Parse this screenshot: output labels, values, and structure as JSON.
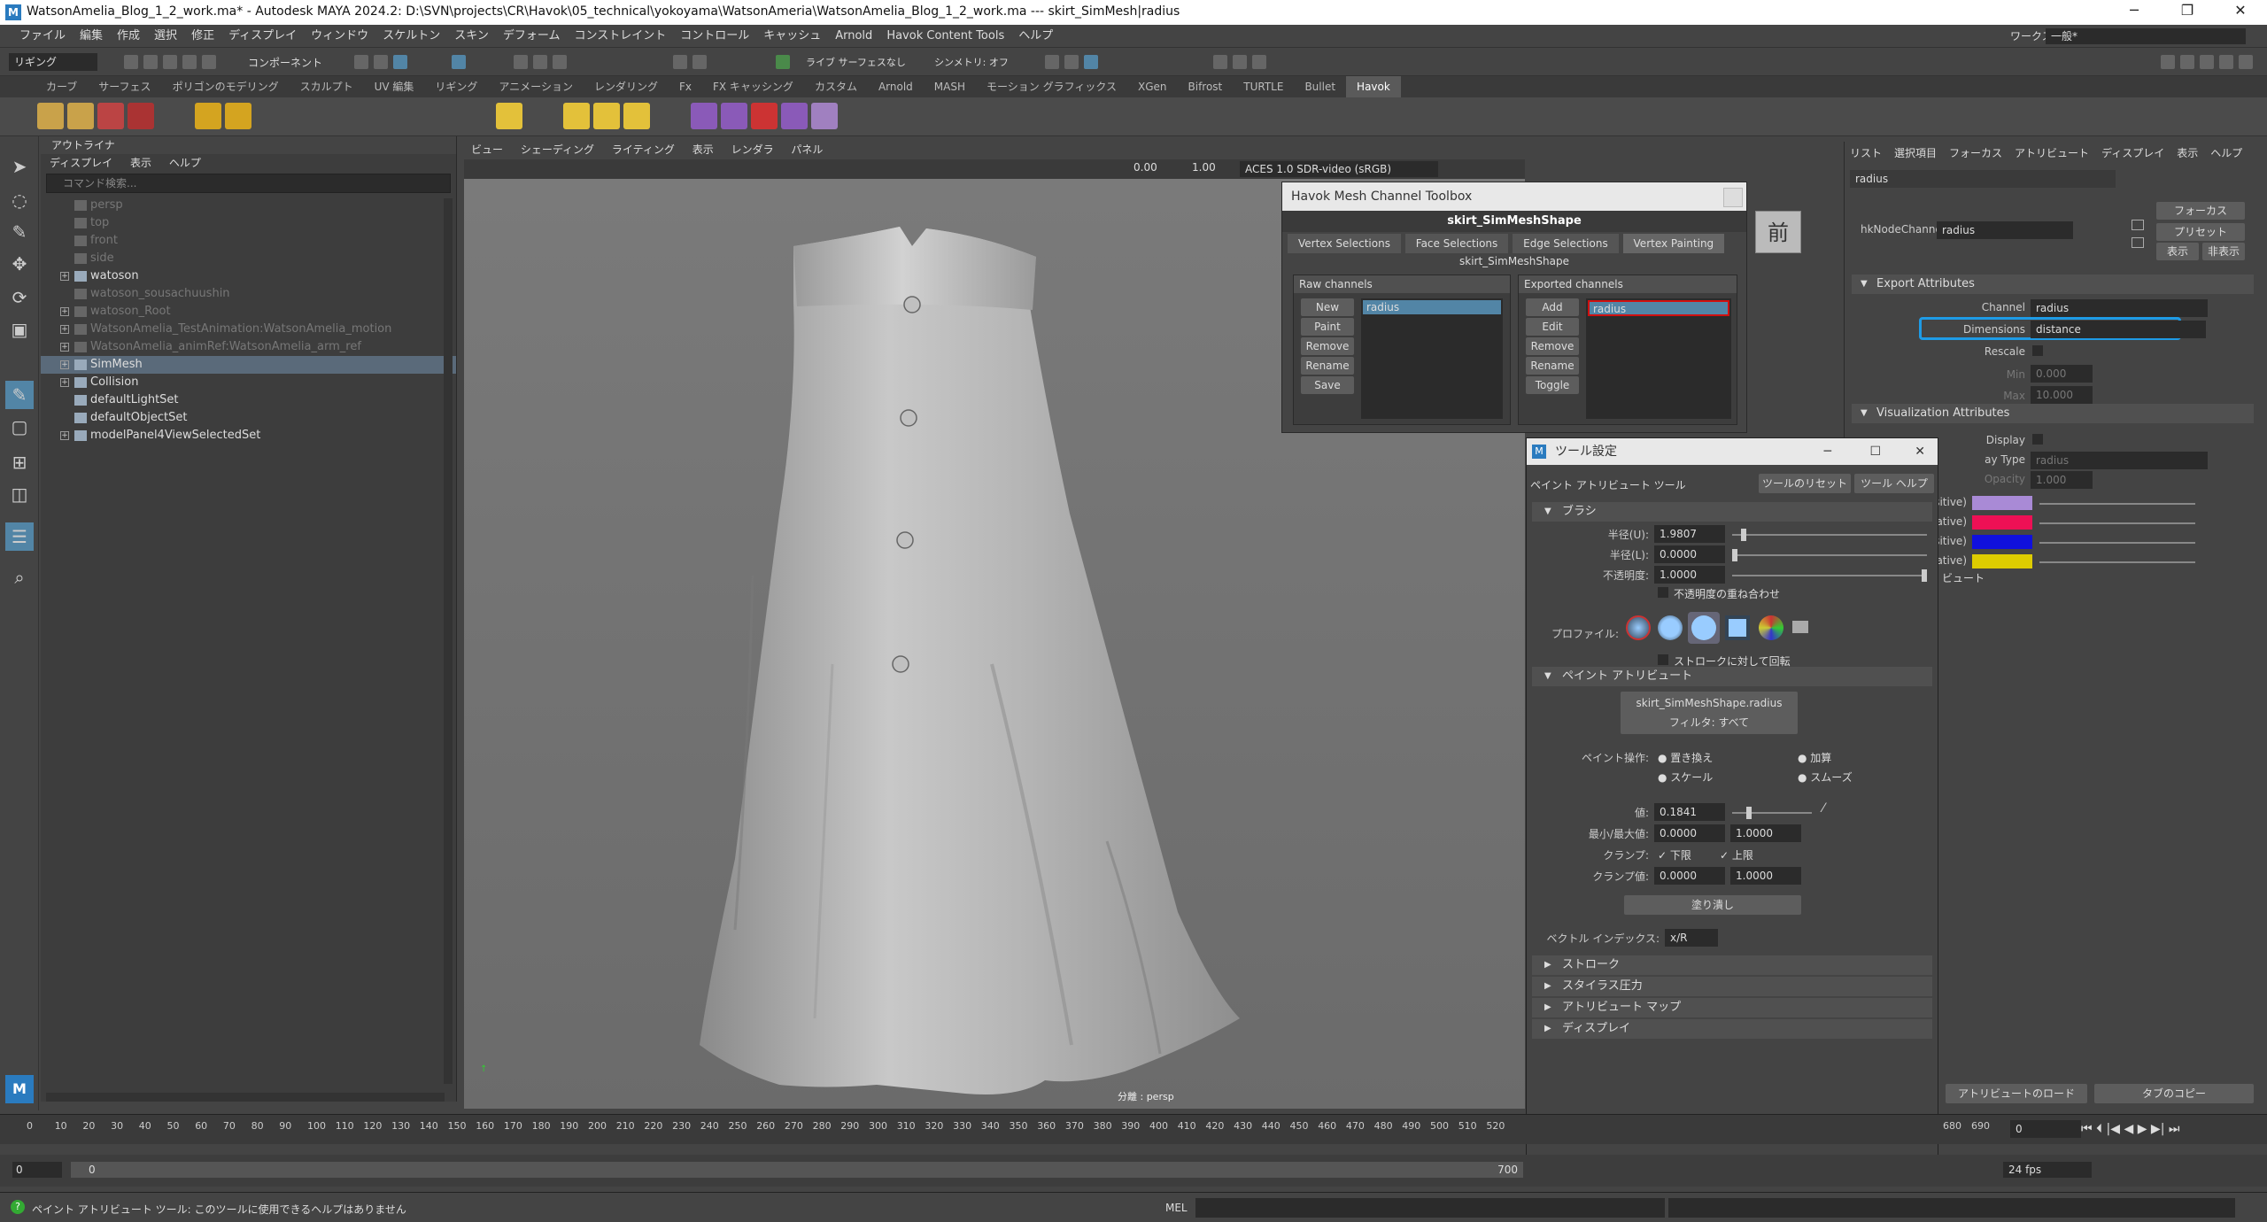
{
  "title": "WatsonAmelia_Blog_1_2_work.ma* - Autodesk MAYA 2024.2: D:\\SVN\\projects\\CR\\Havok\\05_technical\\yokoyama\\WatsonAmeria\\WatsonAmelia_Blog_1_2_work.ma  ---  skirt_SimMesh|radius",
  "menu": [
    "ファイル",
    "編集",
    "作成",
    "選択",
    "修正",
    "ディスプレイ",
    "ウィンドウ",
    "スケルトン",
    "スキン",
    "デフォーム",
    "コンストレイント",
    "コントロール",
    "キャッシュ",
    "Arnold",
    "Havok Content Tools",
    "ヘルプ"
  ],
  "workspace_label": "ワークスペース:",
  "workspace_value": "一般*",
  "mode_select": "リギング",
  "component_label": "コンポーネント",
  "live_label": "ライブ サーフェスなし",
  "symmetry_label": "シンメトリ: オフ",
  "shelf_tabs": [
    "カーブ",
    "サーフェス",
    "ポリゴンのモデリング",
    "スカルプト",
    "UV 編集",
    "リギング",
    "アニメーション",
    "レンダリング",
    "Fx",
    "FX キャッシング",
    "カスタム",
    "Arnold",
    "MASH",
    "モーション グラフィックス",
    "XGen",
    "Bifrost",
    "TURTLE",
    "Bullet",
    "Havok"
  ],
  "outliner": {
    "title": "アウトライナ",
    "menu": [
      "ディスプレイ",
      "表示",
      "ヘルプ"
    ],
    "search_placeholder": "コマンド検索...",
    "rows": [
      {
        "label": "persp",
        "dim": true,
        "exp": false
      },
      {
        "label": "top",
        "dim": true,
        "exp": false
      },
      {
        "label": "front",
        "dim": true,
        "exp": false
      },
      {
        "label": "side",
        "dim": true,
        "exp": false
      },
      {
        "label": "watoson",
        "dim": false,
        "exp": true
      },
      {
        "label": "watoson_sousachuushin",
        "dim": true,
        "exp": false
      },
      {
        "label": "watoson_Root",
        "dim": true,
        "exp": true
      },
      {
        "label": "WatsonAmelia_TestAnimation:WatsonAmelia_motion",
        "dim": true,
        "exp": true
      },
      {
        "label": "WatsonAmelia_animRef:WatsonAmelia_arm_ref",
        "dim": true,
        "exp": true
      },
      {
        "label": "SimMesh",
        "dim": false,
        "exp": true,
        "sel": true
      },
      {
        "label": "Collision",
        "dim": false,
        "exp": true
      },
      {
        "label": "defaultLightSet",
        "dim": false,
        "exp": false
      },
      {
        "label": "defaultObjectSet",
        "dim": false,
        "exp": false
      },
      {
        "label": "modelPanel4ViewSelectedSet",
        "dim": false,
        "exp": true
      }
    ]
  },
  "viewport": {
    "menu": [
      "ビュー",
      "シェーディング",
      "ライティング",
      "表示",
      "レンダラ",
      "パネル"
    ],
    "exposure": "0.00",
    "gamma": "1.00",
    "colorspace": "ACES 1.0 SDR-video (sRGB)",
    "label": "分離 : persp",
    "cube_label": "前"
  },
  "hmct": {
    "title": "Havok Mesh Channel Toolbox",
    "shape": "skirt_SimMeshShape",
    "tabs": [
      "Vertex Selections",
      "Face Selections",
      "Edge Selections",
      "Vertex Painting"
    ],
    "sub_shape": "skirt_SimMeshShape",
    "raw_title": "Raw channels",
    "raw_buttons": [
      "New",
      "Paint",
      "Remove",
      "Rename",
      "Save"
    ],
    "raw_item": "radius",
    "exp_title": "Exported channels",
    "exp_buttons": [
      "Add",
      "Edit",
      "Remove",
      "Rename",
      "Toggle"
    ],
    "exp_item": "radius"
  },
  "attr": {
    "tabs": [
      "リスト",
      "選択項目",
      "フォーカス",
      "アトリビュート",
      "ディスプレイ",
      "表示",
      "ヘルプ"
    ],
    "node": "radius",
    "focus_btn": "フォーカス",
    "preset_btn": "プリセット",
    "show_btn": "表示",
    "hide_btn": "非表示",
    "node_label": "hkNodeChannel:",
    "node_value": "radius",
    "export_title": "Export Attributes",
    "channel_label": "Channel",
    "channel_value": "radius",
    "dim_label": "Dimensions",
    "dim_value": "distance",
    "rescale_label": "Rescale",
    "min_label": "Min",
    "min_value": "0.000",
    "max_label": "Max",
    "max_value": "10.000",
    "vis_title": "Visualization Attributes",
    "display_label": "Display",
    "disp_type_label": "ay Type",
    "disp_type_value": "radius",
    "opacity_label": "Opacity",
    "opacity_value": "1.000",
    "c1_label": "Positive)",
    "c2_label": "egative)",
    "c3_label": "Positive)",
    "c4_label": "egative)",
    "extra_label": "ビュート",
    "load_btn": "アトリビュートのロード",
    "copy_btn": "タブのコピー",
    "colors": [
      "#a98ad6",
      "#ee1055",
      "#1010dd",
      "#ddcc00"
    ]
  },
  "toolset": {
    "title": "ツール設定",
    "tool_name": "ペイント アトリビュート ツール",
    "reset_btn": "ツールのリセット",
    "help_btn": "ツール ヘルプ",
    "brush_title": "ブラシ",
    "radius_u_label": "半径(U):",
    "radius_u": "1.9807",
    "radius_l_label": "半径(L):",
    "radius_l": "0.0000",
    "opacity_label": "不透明度:",
    "opacity": "1.0000",
    "accum_label": "不透明度の重ね合わせ",
    "profile_label": "プロファイル:",
    "rotate_label": "ストロークに対して回転",
    "paint_attr_title": "ペイント アトリビュート",
    "attr_btn": "skirt_SimMeshShape.radius",
    "filter_label": "フィルタ: すべて",
    "paint_op_label": "ペイント操作:",
    "op_replace": "置き換え",
    "op_add": "加算",
    "op_scale": "スケール",
    "op_smooth": "スムーズ",
    "value_label": "値:",
    "value": "0.1841",
    "minmax_label": "最小/最大値:",
    "min": "0.0000",
    "max": "1.0000",
    "clamp_label": "クランプ:",
    "clamp_low": "下限",
    "clamp_high": "上限",
    "clampv_label": "クランプ値:",
    "clamp_min": "0.0000",
    "clamp_max": "1.0000",
    "flood_btn": "塗り潰し",
    "vec_label": "ベクトル インデックス:",
    "vec_value": "x/R",
    "sections": [
      "ストローク",
      "スタイラス圧力",
      "アトリビュート マップ",
      "ディスプレイ"
    ]
  },
  "time": {
    "ticks": [
      "0",
      "10",
      "20",
      "30",
      "40",
      "50",
      "60",
      "70",
      "80",
      "90",
      "100",
      "110",
      "120",
      "130",
      "140",
      "150",
      "160",
      "170",
      "180",
      "190",
      "200",
      "210",
      "220",
      "230",
      "240",
      "250",
      "260",
      "270",
      "280",
      "290",
      "300",
      "310",
      "320",
      "330",
      "340",
      "350",
      "360",
      "370",
      "380",
      "390",
      "400",
      "410",
      "420",
      "430",
      "440",
      "450",
      "460",
      "470",
      "480",
      "490",
      "500",
      "510",
      "520"
    ],
    "ticks_right": [
      "680",
      "690"
    ],
    "current": "0",
    "start": "0",
    "inner_start": "0",
    "end": "700",
    "fps": "24 fps"
  },
  "status": {
    "help_text": "ペイント アトリビュート ツール: このツールに使用できるヘルプはありません",
    "mel": "MEL"
  }
}
